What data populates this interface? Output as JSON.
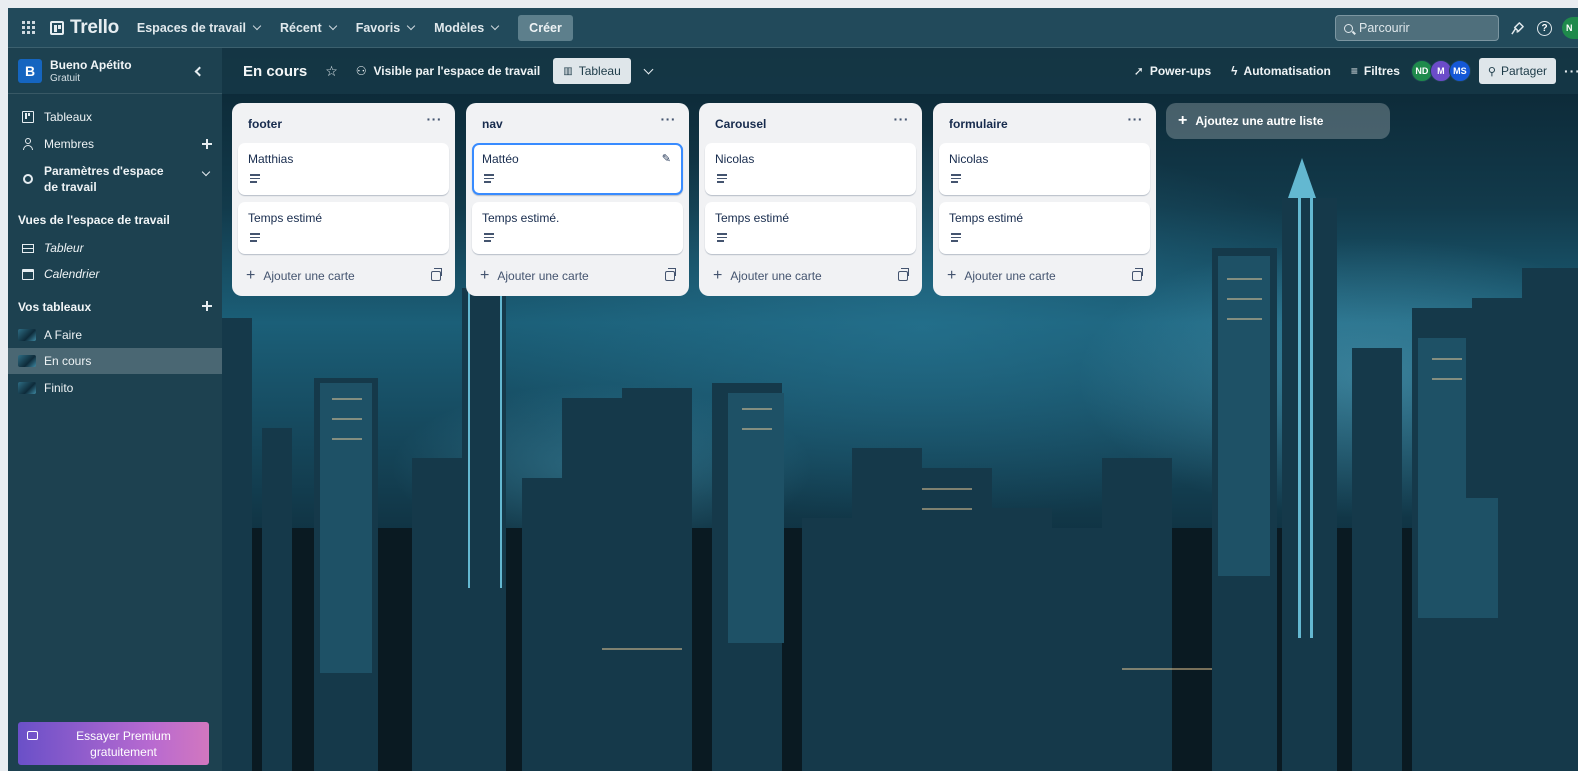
{
  "header": {
    "logo": "Trello",
    "nav": [
      {
        "label": "Espaces de travail"
      },
      {
        "label": "Récent"
      },
      {
        "label": "Favoris"
      },
      {
        "label": "Modèles"
      }
    ],
    "create_label": "Créer",
    "search_placeholder": "Parcourir",
    "avatar_initial": "N"
  },
  "sidebar": {
    "workspace_initial": "B",
    "workspace_name": "Bueno Apétito",
    "workspace_plan": "Gratuit",
    "items": [
      {
        "label": "Tableaux"
      },
      {
        "label": "Membres"
      },
      {
        "label": "Paramètres d'espace de travail"
      }
    ],
    "views_title": "Vues de l'espace de travail",
    "views": [
      {
        "label": "Tableur"
      },
      {
        "label": "Calendrier"
      }
    ],
    "boards_title": "Vos tableaux",
    "boards": [
      {
        "label": "A Faire"
      },
      {
        "label": "En cours"
      },
      {
        "label": "Finito"
      }
    ],
    "premium_label": "Essayer Premium gratuitement"
  },
  "board": {
    "title": "En cours",
    "visibility": "Visible par l'espace de travail",
    "view_label": "Tableau",
    "powerups": "Power-ups",
    "automation": "Automatisation",
    "filters": "Filtres",
    "members": [
      {
        "initials": "ND",
        "color": "#1f8a4c"
      },
      {
        "initials": "M",
        "color": "#6b4cc9"
      },
      {
        "initials": "MS",
        "color": "#1558d6"
      }
    ],
    "share_label": "Partager",
    "add_card_label": "Ajouter une carte",
    "add_list_label": "Ajoutez une autre liste",
    "lists": [
      {
        "title": "footer",
        "cards": [
          {
            "title": "Matthias"
          },
          {
            "title": "Temps estimé"
          }
        ]
      },
      {
        "title": "nav",
        "cards": [
          {
            "title": "Mattéo"
          },
          {
            "title": "Temps estimé."
          }
        ]
      },
      {
        "title": "Carousel",
        "cards": [
          {
            "title": "Nicolas"
          },
          {
            "title": "Temps estimé"
          }
        ]
      },
      {
        "title": "formulaire",
        "cards": [
          {
            "title": "Nicolas"
          },
          {
            "title": "Temps estimé"
          }
        ]
      }
    ]
  },
  "colors": {
    "header_bg": "#224a5b",
    "sidebar_bg": "#1d4150",
    "active_card_border": "#388bff"
  }
}
